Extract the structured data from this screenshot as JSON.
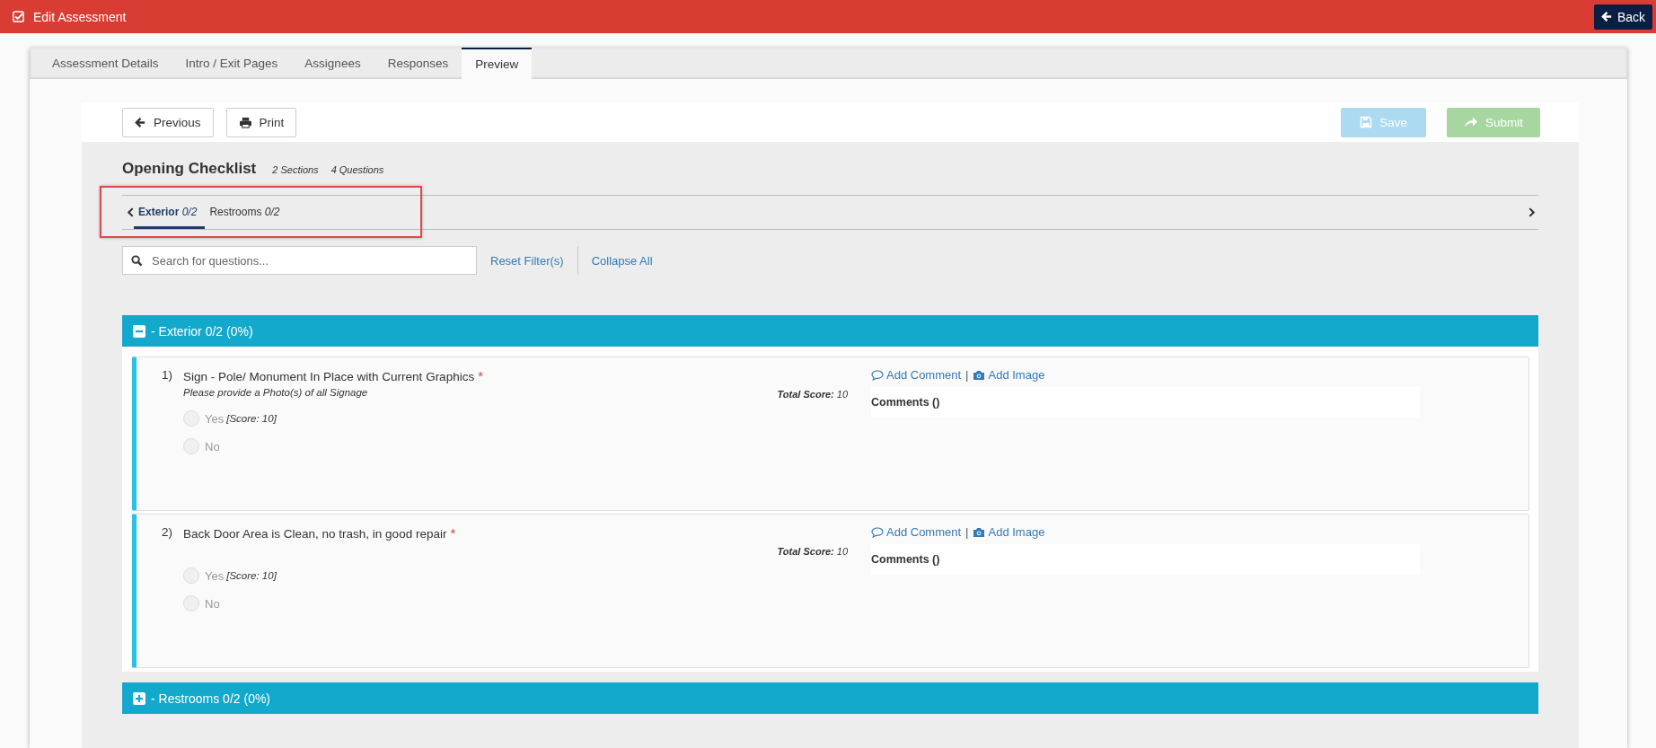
{
  "header": {
    "title": "Edit Assessment",
    "back_button": "Back"
  },
  "tabs": [
    {
      "label": "Assessment Details",
      "selected": false
    },
    {
      "label": "Intro / Exit Pages",
      "selected": false
    },
    {
      "label": "Assignees",
      "selected": false
    },
    {
      "label": "Responses",
      "selected": false
    },
    {
      "label": "Preview",
      "selected": true
    }
  ],
  "toolbar": {
    "left_buttons": [
      {
        "label": "Previous",
        "kind": "previous",
        "disabled": false
      },
      {
        "label": "Print",
        "kind": "print",
        "disabled": false
      }
    ],
    "right_buttons": [
      {
        "label": "Save",
        "kind": "save",
        "disabled": true
      },
      {
        "label": "Submit",
        "kind": "submit",
        "disabled": true
      }
    ]
  },
  "checklist": {
    "title": "Opening Checklist",
    "sections_count": "2 Sections",
    "questions_count": "4 Questions"
  },
  "section_tabs": [
    {
      "name": "Exterior",
      "progress": "0/2",
      "selected": true
    },
    {
      "name": "Restrooms",
      "progress": "0/2",
      "selected": false
    }
  ],
  "section_tabs_highlighted": true,
  "search": {
    "placeholder": "Search for questions..."
  },
  "filter_links": [
    "Reset Filter(s)",
    "Collapse All"
  ],
  "sections": [
    {
      "title": "- Exterior 0/2 (0%)",
      "expanded": true,
      "questions": [
        {
          "number": "1)",
          "text": "Sign - Pole/ Monument In Place with Current Graphics",
          "required_mark": "*",
          "hint": "Please provide a Photo(s) of all Signage",
          "total_score_label": "Total Score:",
          "total_score": "10",
          "options": [
            {
              "label": "Yes",
              "score": "[Score: 10]",
              "selected": false
            },
            {
              "label": "No",
              "selected": false
            }
          ],
          "add_comment": "Add Comment",
          "separator": "|",
          "add_image": "Add Image",
          "comments_label": "Comments ()"
        },
        {
          "number": "2)",
          "text": "Back Door Area is Clean, no trash, in good repair",
          "required_mark": "*",
          "total_score_label": "Total Score:",
          "total_score": "10",
          "options": [
            {
              "label": "Yes",
              "score": "[Score: 10]",
              "selected": false
            },
            {
              "label": "No",
              "selected": false
            }
          ],
          "add_comment": "Add Comment",
          "separator": "|",
          "add_image": "Add Image",
          "comments_label": "Comments ()"
        }
      ]
    },
    {
      "title": "- Restrooms 0/2 (0%)",
      "expanded": false
    }
  ]
}
